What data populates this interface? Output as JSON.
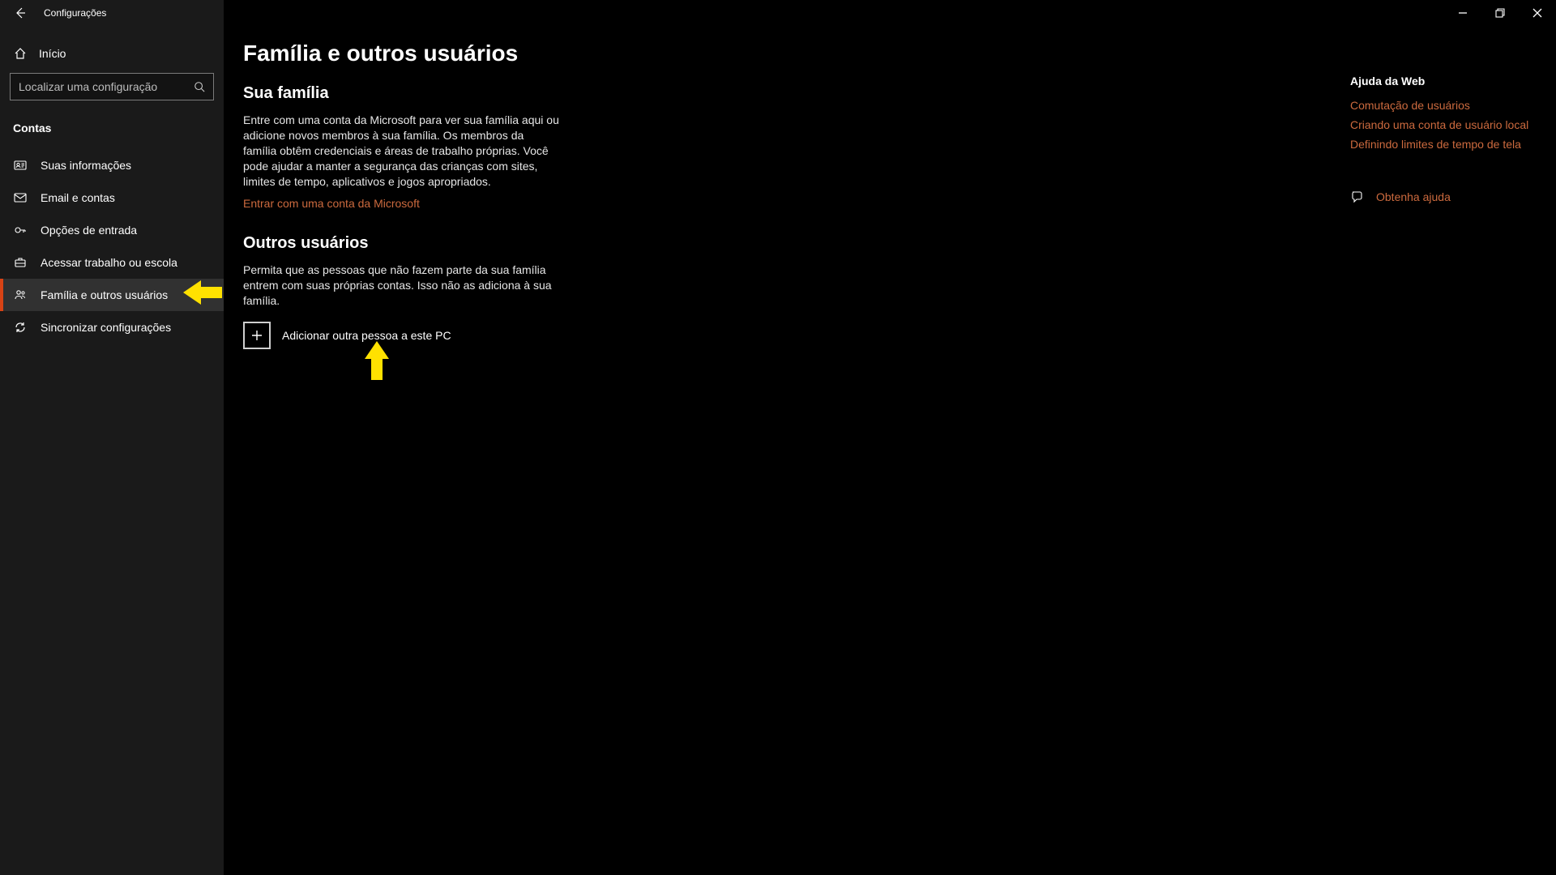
{
  "window": {
    "title": "Configurações"
  },
  "sidebar": {
    "home": "Início",
    "search_placeholder": "Localizar uma configuração",
    "section": "Contas",
    "items": [
      {
        "label": "Suas informações"
      },
      {
        "label": "Email e contas"
      },
      {
        "label": "Opções de entrada"
      },
      {
        "label": "Acessar trabalho ou escola"
      },
      {
        "label": "Família e outros usuários"
      },
      {
        "label": "Sincronizar configurações"
      }
    ]
  },
  "main": {
    "title": "Família e outros usuários",
    "family": {
      "heading": "Sua família",
      "body": "Entre com uma conta da Microsoft para ver sua família aqui ou adicione novos membros à sua família. Os membros da família obtêm credenciais e áreas de trabalho próprias. Você pode ajudar a manter a segurança das crianças com sites, limites de tempo, aplicativos e jogos apropriados.",
      "signin_link": "Entrar com uma conta da Microsoft"
    },
    "others": {
      "heading": "Outros usuários",
      "body": "Permita que as pessoas que não fazem parte da sua família entrem com suas próprias contas. Isso não as adiciona à sua família.",
      "add_label": "Adicionar outra pessoa a este PC"
    }
  },
  "help": {
    "heading": "Ajuda da Web",
    "links": [
      "Comutação de usuários",
      "Criando uma conta de usuário local",
      "Definindo limites de tempo de tela"
    ],
    "get_help": "Obtenha ajuda"
  },
  "colors": {
    "accent": "#cc6a3e"
  }
}
